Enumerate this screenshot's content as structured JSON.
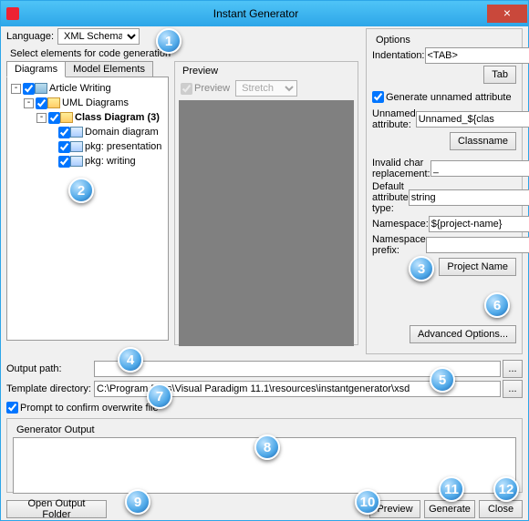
{
  "title": "Instant Generator",
  "language_label": "Language:",
  "language_value": "XML Schema",
  "select_elements_label": "Select elements for code generation",
  "tabs": {
    "diagrams": "Diagrams",
    "model_elements": "Model Elements"
  },
  "tree": {
    "root": "Article Writing",
    "uml": "UML Diagrams",
    "class_diag": "Class Diagram (3)",
    "items": [
      "Domain diagram",
      "pkg: presentation",
      "pkg: writing"
    ]
  },
  "preview_title": "Preview",
  "preview_check": "Preview",
  "stretch": "Stretch",
  "options": {
    "title": "Options",
    "indentation_label": "Indentation:",
    "indentation_value": "<TAB>",
    "tab_btn": "Tab",
    "gen_unnamed": "Generate unnamed attribute",
    "unnamed_label": "Unnamed attribute:",
    "unnamed_value": "Unnamed_${clas",
    "classname_btn": "Classname",
    "invalid_label": "Invalid char replacement:",
    "invalid_value": "_",
    "default_attr_label": "Default attribute type:",
    "default_attr_value": "string",
    "namespace_label": "Namespace:",
    "namespace_value": "${project-name}",
    "nsprefix_label": "Namespace prefix:",
    "nsprefix_value": "",
    "projectname_btn": "Project Name",
    "advanced_btn": "Advanced Options..."
  },
  "output_path_label": "Output path:",
  "output_path_value": "",
  "template_dir_label": "Template directory:",
  "template_dir_value": "C:\\Program Files\\Visual Paradigm 11.1\\resources\\instantgenerator\\xsd",
  "prompt_overwrite": "Prompt to confirm overwrite file",
  "generator_output": "Generator Output",
  "buttons": {
    "open_output": "Open Output Folder",
    "preview": "Preview",
    "generate": "Generate",
    "close": "Close",
    "browse": "..."
  },
  "callouts": [
    "1",
    "2",
    "3",
    "4",
    "5",
    "6",
    "7",
    "8",
    "9",
    "10",
    "11",
    "12"
  ]
}
